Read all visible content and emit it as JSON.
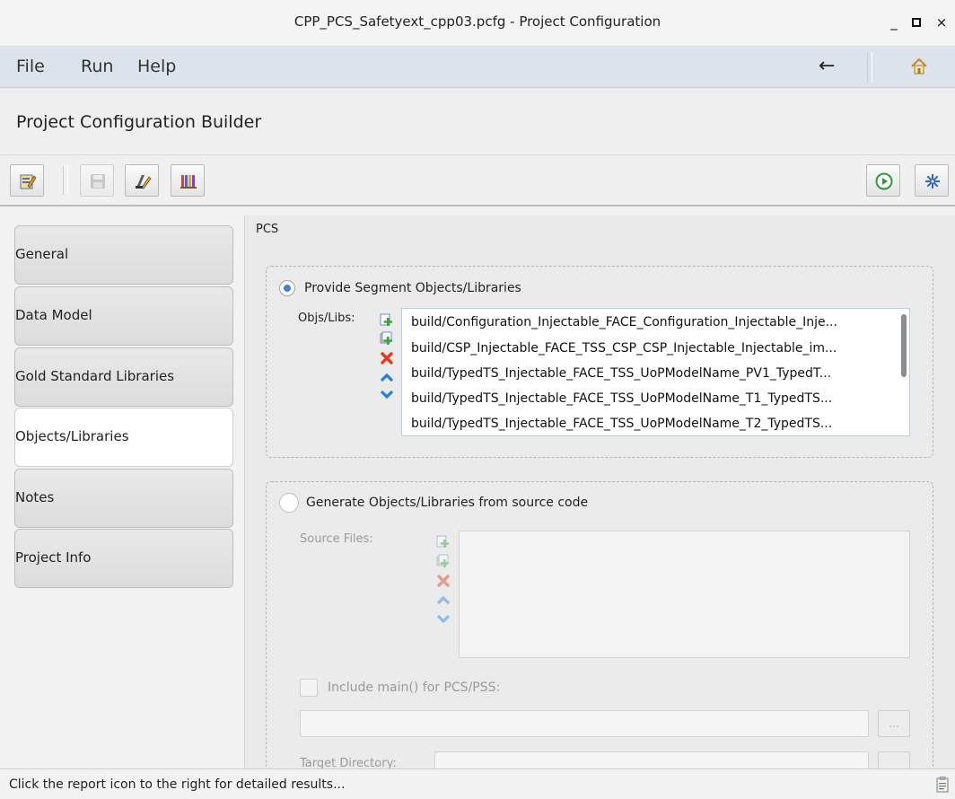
{
  "window": {
    "title": "CPP_PCS_Safetyext_cpp03.pcfg - Project Configuration",
    "minimize_glyph": "_",
    "maximize_glyph": "□",
    "close_glyph": "×"
  },
  "menu": {
    "items": [
      "File",
      "Run",
      "Help"
    ],
    "back_glyph": "←",
    "home_icon": "home-icon"
  },
  "builder": {
    "title": "Project Configuration Builder"
  },
  "toolbar": {
    "left_icons": [
      "edit-config-icon",
      "save-icon",
      "edit-tools-icon",
      "library-icon"
    ],
    "right_icons": [
      "run-icon",
      "settings-icon"
    ]
  },
  "sidebar": {
    "items": [
      {
        "label": "General",
        "active": false
      },
      {
        "label": "Data Model",
        "active": false
      },
      {
        "label": "Gold Standard Libraries",
        "active": false
      },
      {
        "label": "Objects/Libraries",
        "active": true
      },
      {
        "label": "Notes",
        "active": false
      },
      {
        "label": "Project Info",
        "active": false
      }
    ]
  },
  "main": {
    "section_label": "PCS",
    "provide": {
      "label": "Provide Segment Objects/Libraries",
      "selected": true,
      "list_label": "Objs/Libs:",
      "items": [
        "build/Configuration_Injectable_FACE_Configuration_Injectable_Inje...",
        "build/CSP_Injectable_FACE_TSS_CSP_CSP_Injectable_Injectable_im...",
        "build/TypedTS_Injectable_FACE_TSS_UoPModelName_PV1_TypedT...",
        "build/TypedTS_Injectable_FACE_TSS_UoPModelName_T1_TypedTS...",
        "build/TypedTS_Injectable_FACE_TSS_UoPModelName_T2_TypedTS..."
      ]
    },
    "generate": {
      "label": "Generate Objects/Libraries from source code",
      "selected": false,
      "source_files_label": "Source Files:",
      "include_main_label": "Include main() for PCS/PSS:",
      "include_main_checked": false,
      "browse_label": "...",
      "target_dir_label": "Target Directory:"
    }
  },
  "status": {
    "message": "Click the report icon to the right for detailed results..."
  },
  "colors": {
    "menubar_bg": "#dde3ec",
    "accent_blue": "#3d82d6",
    "add_green": "#3aa63a",
    "remove_red": "#e03c1f",
    "move_blue": "#2a7fd6"
  }
}
